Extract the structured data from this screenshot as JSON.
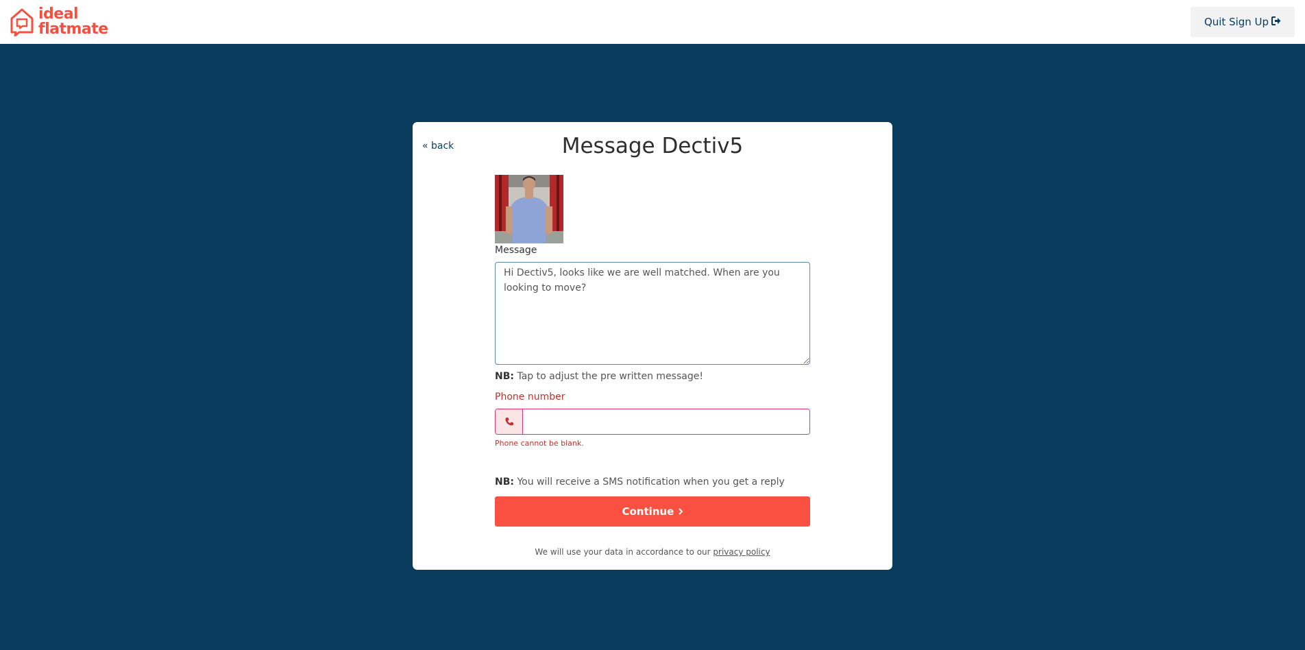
{
  "header": {
    "logo_line1": "ideal",
    "logo_line2": "flatmate",
    "quit_label": "Quit Sign Up"
  },
  "card": {
    "back_label": "« back",
    "title": "Message Dectiv5",
    "message_label": "Message",
    "message_value": "Hi Dectiv5, looks like we are well matched. When are you looking to move?",
    "nb_prefix": "NB:",
    "nb_adjust": "Tap to adjust the pre written message!",
    "phone_label": "Phone number",
    "phone_value": "",
    "phone_error": "Phone cannot be blank.",
    "nb_sms": "You will receive a SMS notification when you get a reply",
    "continue_label": "Continue",
    "privacy_text": "We will use your data in accordance to our",
    "privacy_link": "privacy policy"
  },
  "colors": {
    "brand": "#f5503f",
    "background": "#083b5c",
    "error": "#c4302b"
  },
  "icons": {
    "logo": "house-speech-icon",
    "quit": "sign-out-icon",
    "phone": "phone-icon",
    "continue": "chevron-right-icon"
  }
}
